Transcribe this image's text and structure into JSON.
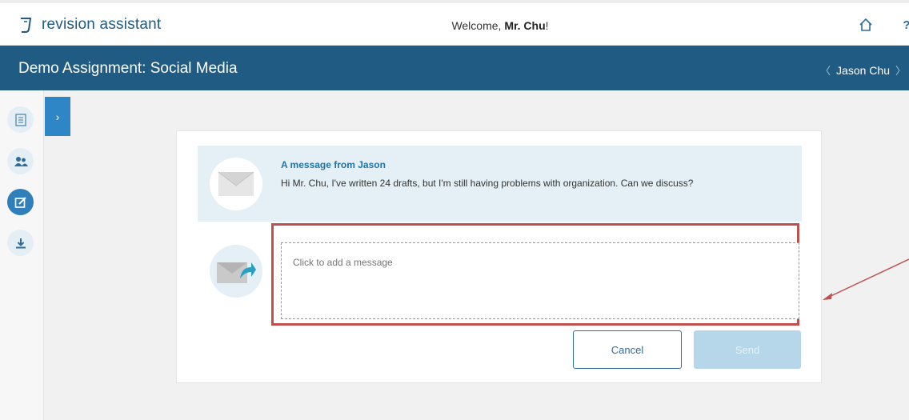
{
  "topbar": {
    "logo_text": "revision assistant",
    "welcome_prefix": "Welcome, ",
    "welcome_name": "Mr. Chu",
    "welcome_suffix": "!",
    "help_label": "?"
  },
  "header": {
    "title": "Demo Assignment: Social Media",
    "student_name": "Jason Chu",
    "prev_chevron": "〈",
    "next_chevron": "〉"
  },
  "sidebar": {
    "items": [
      {
        "icon": "document-icon"
      },
      {
        "icon": "people-icon"
      },
      {
        "icon": "edit-icon"
      },
      {
        "icon": "download-icon"
      }
    ],
    "expand_label": "›"
  },
  "message": {
    "from_label": "A message from Jason",
    "body": "Hi Mr. Chu, I've written 24 drafts, but I'm still having problems with organization. Can we discuss?"
  },
  "reply": {
    "placeholder": "Click to add a message",
    "cancel_label": "Cancel",
    "send_label": "Send"
  },
  "colors": {
    "brand": "#1f5b83",
    "accent": "#2f86c6",
    "highlight": "#c0504d"
  }
}
